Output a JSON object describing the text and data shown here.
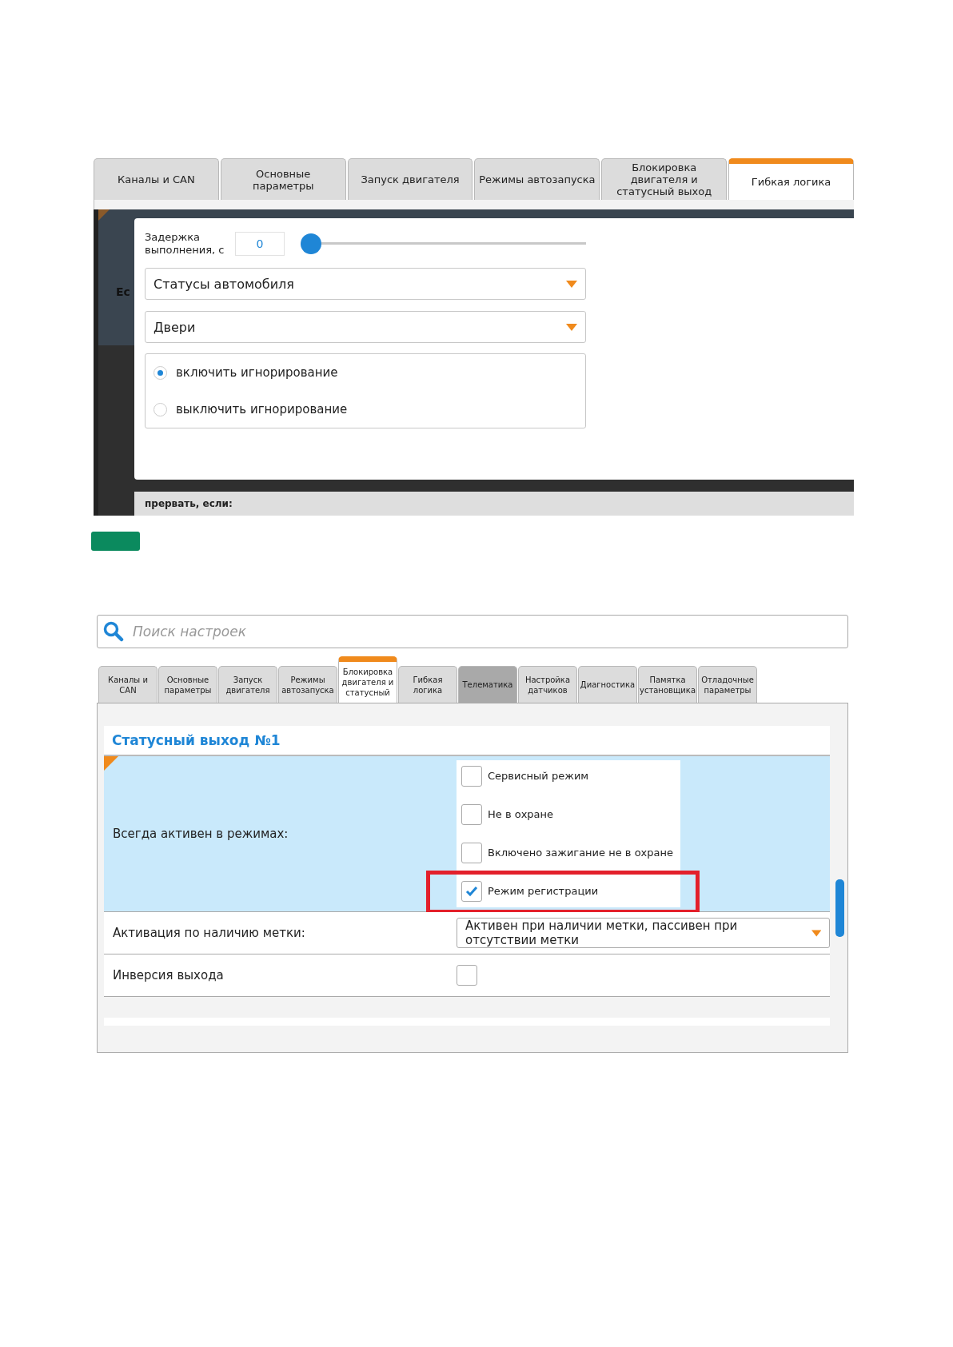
{
  "screenshot_1": {
    "tabs": [
      {
        "label": "Каналы и CAN",
        "selected": false
      },
      {
        "label": "Основные параметры",
        "selected": false
      },
      {
        "label": "Запуск двигателя",
        "selected": false
      },
      {
        "label": "Режимы автозапуска",
        "selected": false
      },
      {
        "label": "Блокировка двигателя и статусный выход",
        "selected": false
      },
      {
        "label": "Гибкая логика",
        "selected": true
      }
    ],
    "background_text": "Ес",
    "delay": {
      "label": "Задержка выполнения, с",
      "value": "0",
      "level": 0
    },
    "dropdowns": [
      "Статусы автомобиля",
      "Двери"
    ],
    "radio_options": [
      {
        "label": "включить игнорирование",
        "selected": true
      },
      {
        "label": "выключить игнорирование",
        "selected": false
      }
    ],
    "footer_bar": "прервать, если:"
  },
  "screenshot_2": {
    "search": {
      "placeholder": "Поиск настроек"
    },
    "tabs": [
      {
        "label": "Каналы и CAN",
        "selected": false,
        "hovered": false
      },
      {
        "label": "Основные параметры",
        "selected": false,
        "hovered": false
      },
      {
        "label": "Запуск двигателя",
        "selected": false,
        "hovered": false
      },
      {
        "label": "Режимы автозапуска",
        "selected": false,
        "hovered": false
      },
      {
        "label": "Блокировка двигателя и статусный",
        "selected": true,
        "hovered": false
      },
      {
        "label": "Гибкая логика",
        "selected": false,
        "hovered": false
      },
      {
        "label": "Телематика",
        "selected": false,
        "hovered": true
      },
      {
        "label": "Настройка датчиков",
        "selected": false,
        "hovered": false
      },
      {
        "label": "Диагностика",
        "selected": false,
        "hovered": false
      },
      {
        "label": "Памятка установщика",
        "selected": false,
        "hovered": false
      },
      {
        "label": "Отладочные параметры",
        "selected": false,
        "hovered": false
      }
    ],
    "section_title": "Статусный выход №1",
    "rows": [
      {
        "kind": "checklist",
        "label": "Всегда активен в режимах:",
        "options": [
          {
            "label": "Сервисный режим",
            "checked": false,
            "highlighted": false
          },
          {
            "label": "Не в охране",
            "checked": false,
            "highlighted": false
          },
          {
            "label": "Включено зажигание не в охране",
            "checked": false,
            "highlighted": false
          },
          {
            "label": "Режим регистрации",
            "checked": true,
            "highlighted": true
          }
        ]
      },
      {
        "kind": "dropdown",
        "label": "Активация по наличию метки:",
        "value": "Активен при наличии метки, пассивен при отсутствии метки"
      },
      {
        "kind": "checkbox",
        "label": "Инверсия выхода",
        "checked": false
      }
    ]
  }
}
